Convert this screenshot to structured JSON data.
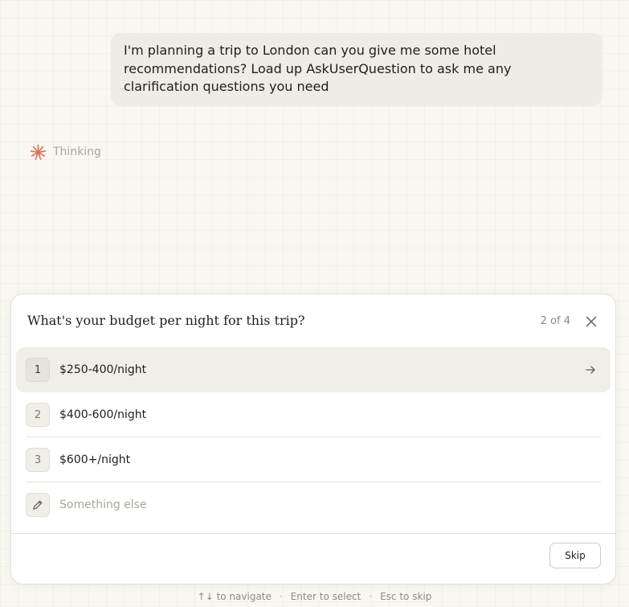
{
  "conversation": {
    "user_message": "I'm planning a trip to London can you give me some hotel recommendations? Load up AskUserQuestion to ask me any clarification questions you need",
    "thinking_label": "Thinking",
    "thinking_icon": "sparkle-asterisk-icon",
    "accent_color": "#d97757"
  },
  "question_card": {
    "title": "What's your budget per night for this trip?",
    "progress": "2 of 4",
    "close_icon": "close-icon",
    "options": [
      {
        "number": "1",
        "label": "$250-400/night",
        "highlighted": true
      },
      {
        "number": "2",
        "label": "$400-600/night",
        "highlighted": false
      },
      {
        "number": "3",
        "label": "$600+/night",
        "highlighted": false
      }
    ],
    "custom_option": {
      "icon": "pencil-icon",
      "placeholder": "Something else"
    },
    "skip_label": "Skip"
  },
  "hints": {
    "navigate": "↑↓ to navigate",
    "select": "Enter to select",
    "skip": "Esc to skip",
    "separator": "·"
  }
}
